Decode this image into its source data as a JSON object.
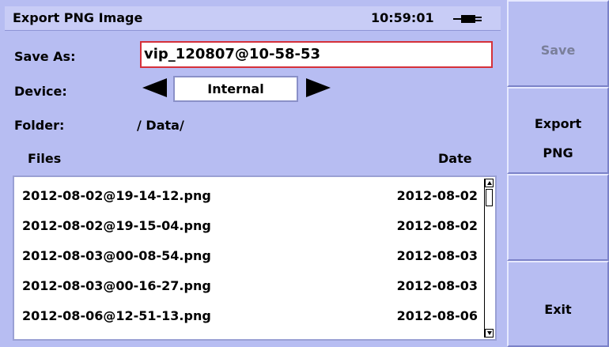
{
  "header": {
    "title": "Export PNG Image",
    "time": "10:59:01"
  },
  "form": {
    "save_as_label": "Save As:",
    "save_as_value": "vip_120807@10-58-53",
    "device_label": "Device:",
    "device_value": "Internal",
    "folder_label": "Folder:",
    "folder_value": "/ Data/"
  },
  "list": {
    "col_files": "Files",
    "col_date": "Date",
    "rows": [
      {
        "name": "2012-08-02@19-14-12.png",
        "date": "2012-08-02"
      },
      {
        "name": "2012-08-02@19-15-04.png",
        "date": "2012-08-02"
      },
      {
        "name": "2012-08-03@00-08-54.png",
        "date": "2012-08-03"
      },
      {
        "name": "2012-08-03@00-16-27.png",
        "date": "2012-08-03"
      },
      {
        "name": "2012-08-06@12-51-13.png",
        "date": "2012-08-06"
      }
    ]
  },
  "side": {
    "save": "Save",
    "export_line1": "Export",
    "export_line2": "PNG",
    "exit": "Exit"
  },
  "icons": {
    "battery": "battery-plug-icon",
    "left": "arrow-left-icon",
    "right": "arrow-right-icon"
  }
}
